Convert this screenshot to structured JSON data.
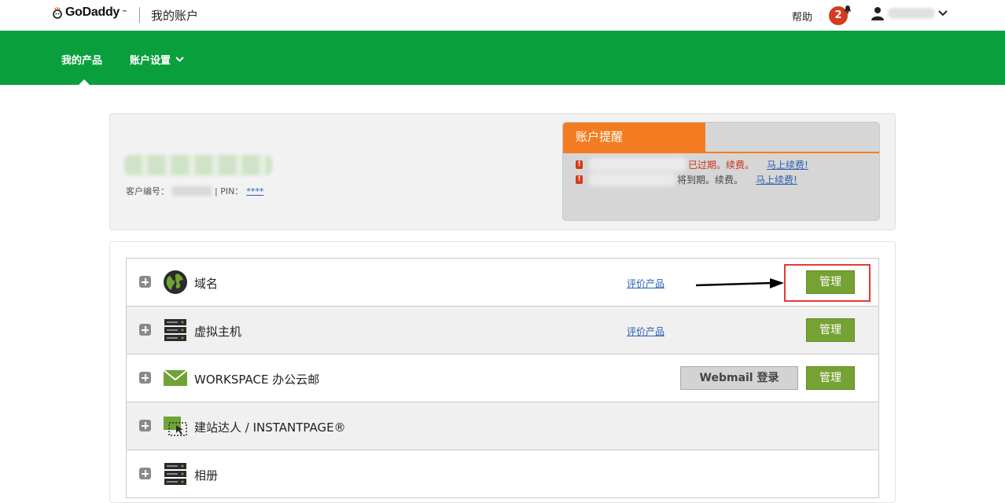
{
  "header": {
    "logo_text": "GoDaddy",
    "logo_tm": "™",
    "title": "我的账户",
    "help": "帮助",
    "notification_count": "2"
  },
  "nav": {
    "products": "我的产品",
    "settings": "账户设置"
  },
  "account": {
    "customer_no_label": "客户编号：",
    "pin_label": "| PIN：",
    "pin_value": "****"
  },
  "alerts": {
    "title": "账户提醒",
    "items": [
      {
        "status": "已过期。续费。",
        "action": "马上续费!"
      },
      {
        "status": "将到期。续费。",
        "action": "马上续费!"
      }
    ]
  },
  "products": [
    {
      "name": "域名",
      "icon": "globe-icon",
      "rate": "评价产品",
      "manage": "管理"
    },
    {
      "name": "虚拟主机",
      "icon": "server-icon",
      "rate": "评价产品",
      "manage": "管理"
    },
    {
      "name": "WORKSPACE 办公云邮",
      "icon": "envelope-icon",
      "webmail": "Webmail 登录",
      "manage": "管理"
    },
    {
      "name": "建站达人 / INSTANTPAGE®",
      "icon": "website-builder-icon"
    },
    {
      "name": "相册",
      "icon": "server-icon"
    }
  ],
  "colors": {
    "brand_green": "#0a9f3d",
    "manage_green": "#76a233",
    "alert_orange": "#f47c20",
    "highlight_red": "#e53935"
  }
}
